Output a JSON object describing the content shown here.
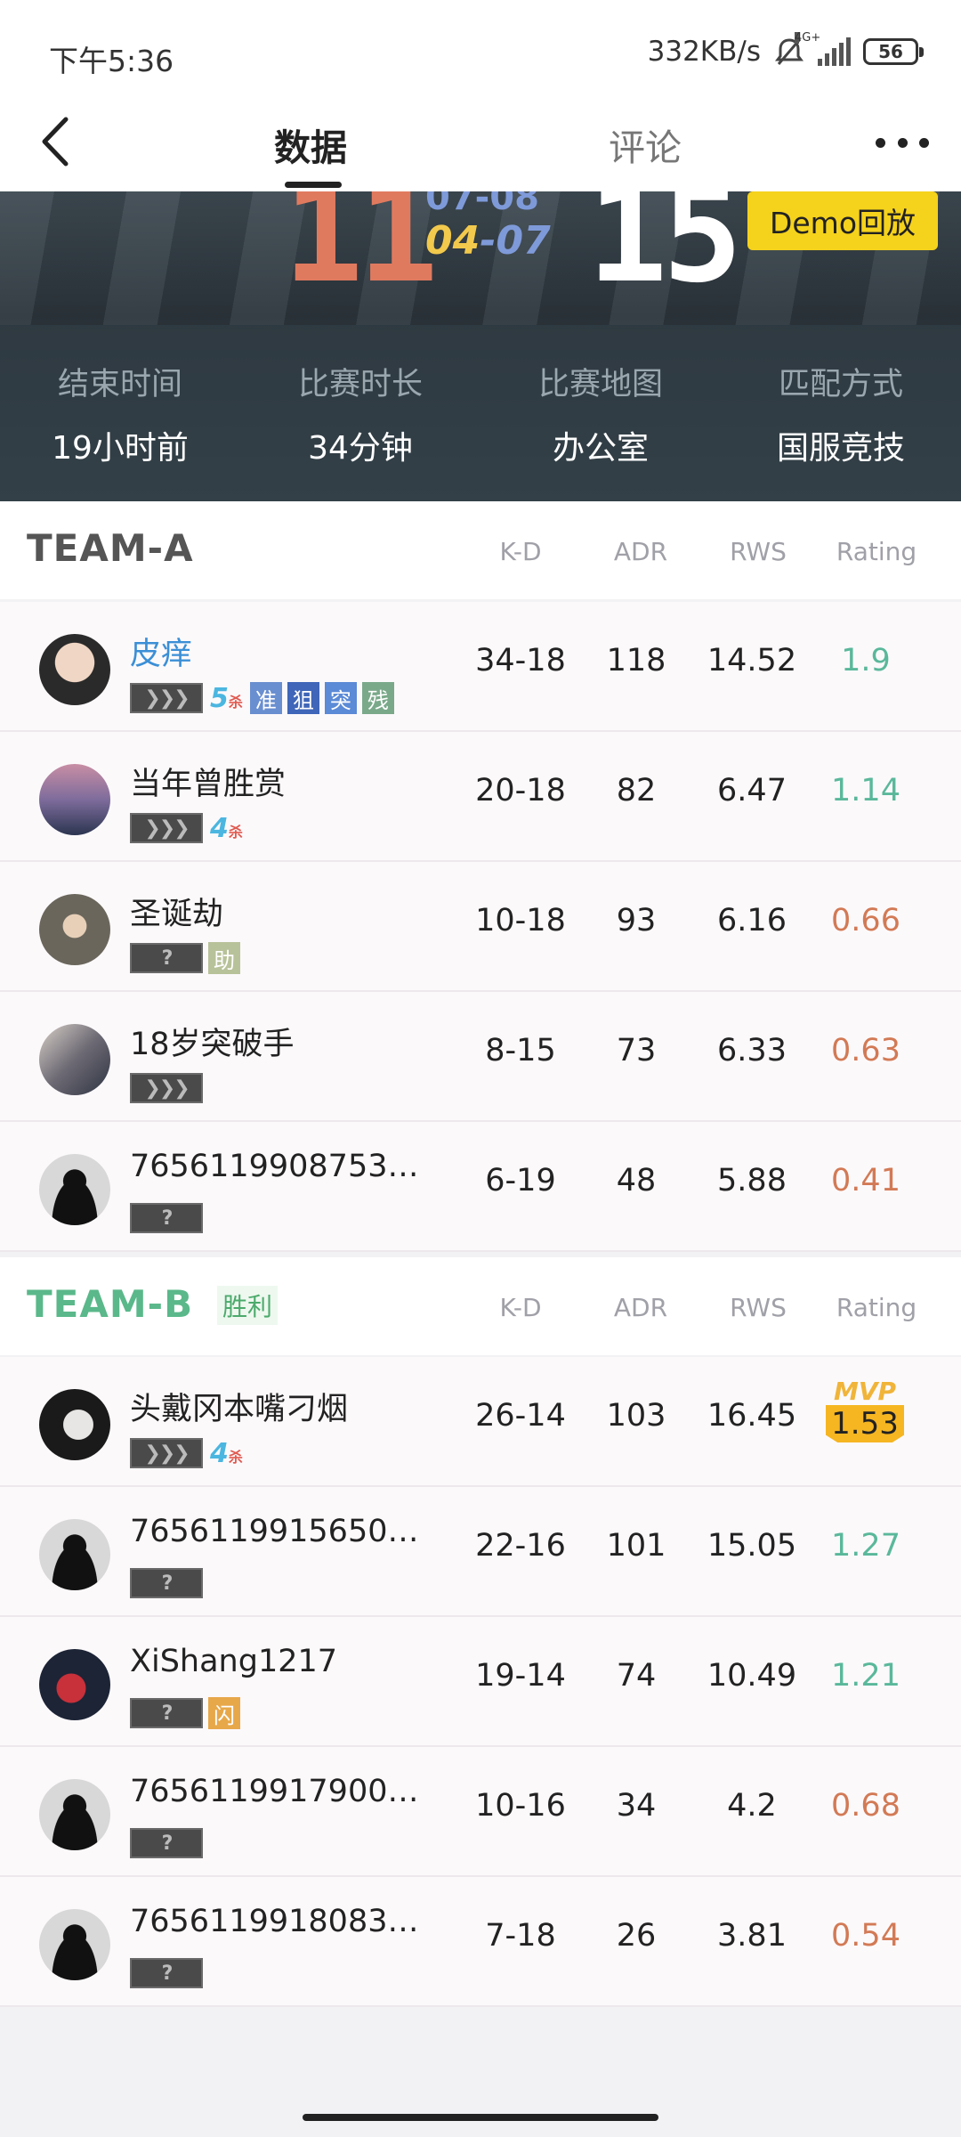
{
  "status_bar": {
    "time": "下午5:36",
    "speed": "332KB/s",
    "battery": "56",
    "network": "4G+"
  },
  "nav": {
    "tab_data": "数据",
    "tab_comments": "评论"
  },
  "banner": {
    "score_a": "11",
    "score_b": "15",
    "date_top": "07-08",
    "date_month": "04",
    "date_sep": "-",
    "date_day": "07",
    "demo_label": "Demo回放",
    "info": [
      {
        "label": "结束时间",
        "value": "19小时前"
      },
      {
        "label": "比赛时长",
        "value": "34分钟"
      },
      {
        "label": "比赛地图",
        "value": "办公室"
      },
      {
        "label": "匹配方式",
        "value": "国服竞技"
      }
    ]
  },
  "columns": {
    "kd": "K-D",
    "adr": "ADR",
    "rws": "RWS",
    "rating": "Rating"
  },
  "team_a": {
    "name": "TEAM-A",
    "players": [
      {
        "name": "皮痒",
        "kd": "34-18",
        "adr": "118",
        "rws": "14.52",
        "rating": "1.9",
        "kills": "5",
        "kill_suffix": "杀",
        "tags": [
          "准",
          "狙",
          "突",
          "残"
        ]
      },
      {
        "name": "当年曾胜赏",
        "kd": "20-18",
        "adr": "82",
        "rws": "6.47",
        "rating": "1.14",
        "kills": "4",
        "kill_suffix": "杀"
      },
      {
        "name": "圣诞劫",
        "kd": "10-18",
        "adr": "93",
        "rws": "6.16",
        "rating": "0.66",
        "tags": [
          "助"
        ]
      },
      {
        "name": "18岁突破手",
        "kd": "8-15",
        "adr": "73",
        "rws": "6.33",
        "rating": "0.63"
      },
      {
        "name": "76561199087534...",
        "kd": "6-19",
        "adr": "48",
        "rws": "5.88",
        "rating": "0.41"
      }
    ]
  },
  "team_b": {
    "name": "TEAM-B",
    "win_label": "胜利",
    "players": [
      {
        "name": "头戴冈本嘴刁烟",
        "kd": "26-14",
        "adr": "103",
        "rws": "16.45",
        "rating": "1.53",
        "mvp": "MVP",
        "kills": "4",
        "kill_suffix": "杀"
      },
      {
        "name": "76561199156508...",
        "kd": "22-16",
        "adr": "101",
        "rws": "15.05",
        "rating": "1.27"
      },
      {
        "name": "XiShang1217",
        "kd": "19-14",
        "adr": "74",
        "rws": "10.49",
        "rating": "1.21",
        "tags": [
          "闪"
        ]
      },
      {
        "name": "76561199179008...",
        "kd": "10-16",
        "adr": "34",
        "rws": "4.2",
        "rating": "0.68"
      },
      {
        "name": "76561199180834...",
        "kd": "7-18",
        "adr": "26",
        "rws": "3.81",
        "rating": "0.54"
      }
    ]
  },
  "rank_glyph": "❯❯❯",
  "unknown_rank": "?",
  "colors": {
    "rating_good": "#5ab89a",
    "rating_bad": "#d27a55",
    "team_b": "#5ab88a",
    "mvp": "#f5b622"
  }
}
